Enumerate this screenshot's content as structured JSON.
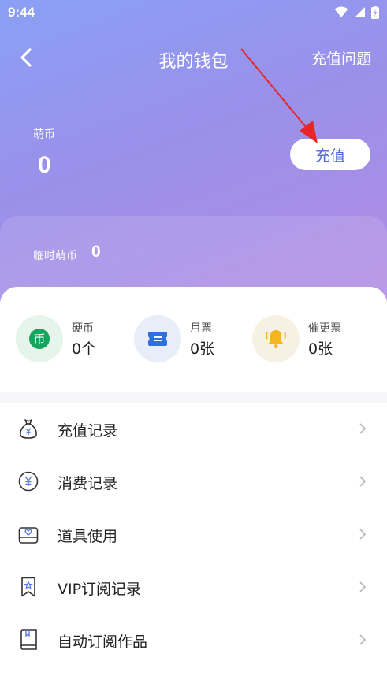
{
  "status_bar": {
    "time": "9:44"
  },
  "nav": {
    "title": "我的钱包",
    "help_label": "充值问题"
  },
  "coins": {
    "label": "萌币",
    "value": "0"
  },
  "recharge_button": {
    "label": "充值"
  },
  "temp_coins": {
    "label": "临时萌币",
    "value": "0"
  },
  "assets": [
    {
      "name": "硬币",
      "value": "0个",
      "icon": "coin-icon",
      "icon_glyph": "币",
      "icon_bg": "#e6f5ec",
      "icon_color": "#16a55c"
    },
    {
      "name": "月票",
      "value": "0张",
      "icon": "ticket-icon",
      "icon_bg": "#e8eef8",
      "icon_color": "#2f6fe0"
    },
    {
      "name": "催更票",
      "value": "0张",
      "icon": "bell-icon",
      "icon_bg": "#f7f1e3",
      "icon_color": "#f5b521"
    }
  ],
  "menu": [
    {
      "label": "充值记录",
      "icon": "money-bag-icon"
    },
    {
      "label": "消费记录",
      "icon": "yen-circle-icon"
    },
    {
      "label": "道具使用",
      "icon": "gift-box-icon"
    },
    {
      "label": "VIP订阅记录",
      "icon": "bookmark-star-icon"
    },
    {
      "label": "自动订阅作品",
      "icon": "book-icon"
    }
  ],
  "colors": {
    "accent": "#4a67d6",
    "header_start": "#8aa0f4",
    "header_end": "#b48ce2",
    "annotation_arrow": "#e8262a"
  }
}
